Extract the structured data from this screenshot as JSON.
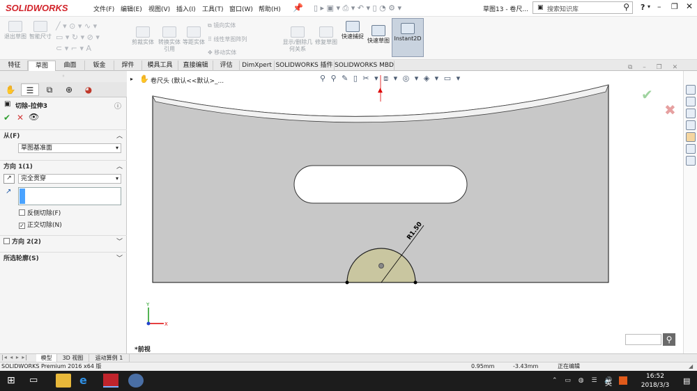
{
  "app": {
    "logo_text": "SOLIDWORKS",
    "doc_title": "草图13 - 卷尺...",
    "search_placeholder": "搜索知识库",
    "help_label": "?"
  },
  "menu": [
    "文件(F)",
    "编辑(E)",
    "视图(V)",
    "插入(I)",
    "工具(T)",
    "窗口(W)",
    "帮助(H)"
  ],
  "ribbon": {
    "buttons": [
      {
        "label": "退出草图",
        "state": "disabled"
      },
      {
        "label": "智能尺寸",
        "state": "disabled"
      },
      {
        "label": "剪裁实体",
        "state": "disabled"
      },
      {
        "label": "转换实体引用",
        "state": "disabled"
      },
      {
        "label": "等距实体",
        "state": "disabled"
      },
      {
        "label": "镜向实体",
        "state": "disabled"
      },
      {
        "label": "线性草图阵列",
        "state": "disabled"
      },
      {
        "label": "移动实体",
        "state": "disabled"
      },
      {
        "label": "显示/删除几何关系",
        "state": "disabled"
      },
      {
        "label": "修复草图",
        "state": "disabled"
      },
      {
        "label": "快速捕捉",
        "state": "enabled"
      },
      {
        "label": "快速草图",
        "state": "enabled"
      },
      {
        "label": "Instant2D",
        "state": "active"
      }
    ]
  },
  "tabs": [
    "特征",
    "草图",
    "曲面",
    "钣金",
    "焊件",
    "模具工具",
    "直接编辑",
    "评估",
    "DimXpert",
    "SOLIDWORKS 插件",
    "SOLIDWORKS MBD"
  ],
  "active_tab": "草图",
  "property_manager": {
    "title": "切除-拉伸3",
    "from_label": "从(F)",
    "from_value": "草图基准面",
    "dir1_label": "方向 1(1)",
    "dir1_value": "完全贯穿",
    "flip_label": "反侧切除(F)",
    "normal_cut_label": "正交切除(N)",
    "normal_cut_checked": true,
    "dir2_label": "方向 2(2)",
    "contours_label": "所选轮廓(S)"
  },
  "viewport": {
    "tree_label": "卷尺头 (默认<<默认>_...",
    "dimension_label": "R1.50",
    "view_label": "*前视"
  },
  "bottom_tabs": [
    "模型",
    "3D 视图",
    "运动算例 1"
  ],
  "status": {
    "product": "SOLIDWORKS Premium 2016 x64 版",
    "x": "0.95mm",
    "y": "-3.43mm",
    "mode": "正在编辑"
  },
  "taskbar": {
    "ime": "英",
    "time": "16:52",
    "date": "2018/3/3"
  }
}
